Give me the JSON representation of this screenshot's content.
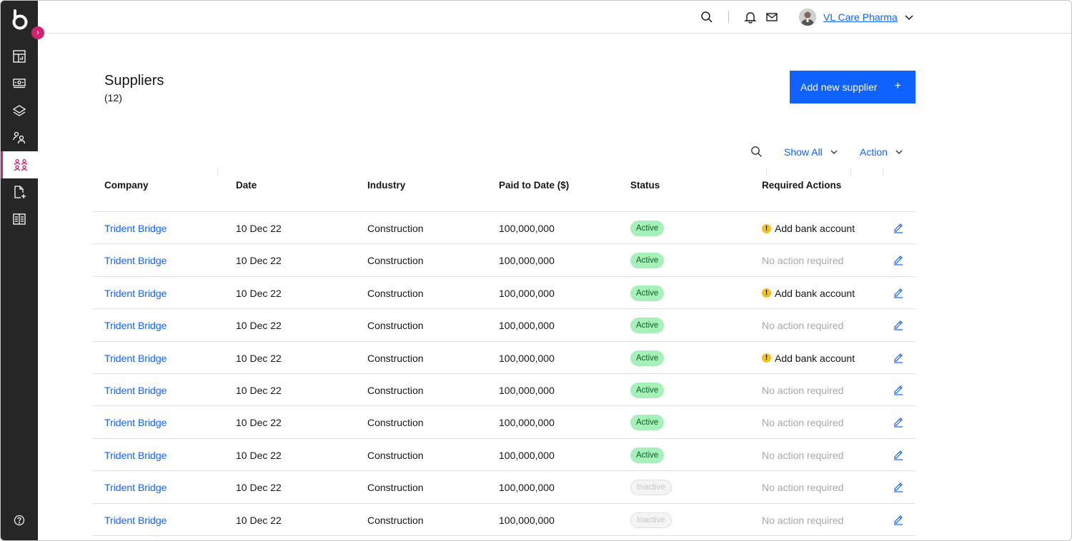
{
  "header": {
    "company_name": "VL Care Pharma",
    "icons": [
      "search-icon",
      "notification-icon",
      "mail-icon",
      "chevron-down-icon"
    ]
  },
  "sidebar": {
    "items": [
      {
        "icon": "dashboard-icon"
      },
      {
        "icon": "payments-icon"
      },
      {
        "icon": "layers-icon"
      },
      {
        "icon": "customers-icon"
      },
      {
        "icon": "suppliers-icon",
        "active": true
      },
      {
        "icon": "add-document-icon"
      },
      {
        "icon": "ledger-icon"
      }
    ],
    "help_icon": "help-icon"
  },
  "page": {
    "title": "Suppliers",
    "count": "(12)",
    "add_button": "Add new supplier",
    "add_button_icon": "+"
  },
  "toolbar": {
    "filter_label": "Show All",
    "action_label": "Action"
  },
  "table": {
    "columns": [
      "Company",
      "Date",
      "Industry",
      "Paid to Date ($)",
      "Status",
      "Required Actions"
    ],
    "rows": [
      {
        "company": "Trident Bridge",
        "date": "10 Dec 22",
        "industry": "Construction",
        "paid": "100,000,000",
        "status": "Active",
        "action": "Add bank account",
        "warn": true
      },
      {
        "company": "Trident Bridge",
        "date": "10 Dec 22",
        "industry": "Construction",
        "paid": "100,000,000",
        "status": "Active",
        "action": "No action required",
        "warn": false
      },
      {
        "company": "Trident Bridge",
        "date": "10 Dec 22",
        "industry": "Construction",
        "paid": "100,000,000",
        "status": "Active",
        "action": "Add bank account",
        "warn": true
      },
      {
        "company": "Trident Bridge",
        "date": "10 Dec 22",
        "industry": "Construction",
        "paid": "100,000,000",
        "status": "Active",
        "action": "No action required",
        "warn": false
      },
      {
        "company": "Trident Bridge",
        "date": "10 Dec 22",
        "industry": "Construction",
        "paid": "100,000,000",
        "status": "Active",
        "action": "Add bank account",
        "warn": true
      },
      {
        "company": "Trident Bridge",
        "date": "10 Dec 22",
        "industry": "Construction",
        "paid": "100,000,000",
        "status": "Active",
        "action": "No action required",
        "warn": false
      },
      {
        "company": "Trident Bridge",
        "date": "10 Dec 22",
        "industry": "Construction",
        "paid": "100,000,000",
        "status": "Active",
        "action": "No action required",
        "warn": false
      },
      {
        "company": "Trident Bridge",
        "date": "10 Dec 22",
        "industry": "Construction",
        "paid": "100,000,000",
        "status": "Active",
        "action": "No action required",
        "warn": false
      },
      {
        "company": "Trident Bridge",
        "date": "10 Dec 22",
        "industry": "Construction",
        "paid": "100,000,000",
        "status": "Inactive",
        "action": "No action required",
        "warn": false
      },
      {
        "company": "Trident Bridge",
        "date": "10 Dec 22",
        "industry": "Construction",
        "paid": "100,000,000",
        "status": "Inactive",
        "action": "No action required",
        "warn": false
      }
    ]
  },
  "colors": {
    "primary": "#0f62fe",
    "sidebar": "#262626",
    "accent": "#d1236e",
    "active_badge": "#a7f0ba",
    "warning": "#f1c21b"
  }
}
